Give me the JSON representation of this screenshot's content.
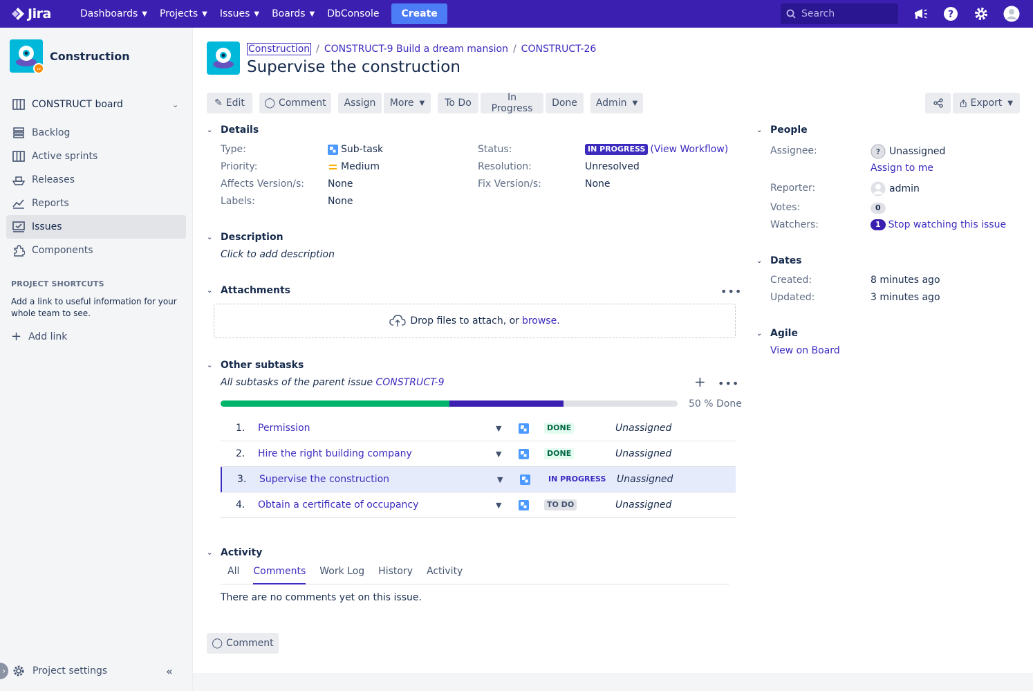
{
  "topnav": {
    "logo_text": "Jira",
    "items": [
      {
        "label": "Dashboards",
        "has_menu": true
      },
      {
        "label": "Projects",
        "has_menu": true
      },
      {
        "label": "Issues",
        "has_menu": true
      },
      {
        "label": "Boards",
        "has_menu": true
      },
      {
        "label": "DbConsole",
        "has_menu": false
      }
    ],
    "create_label": "Create",
    "search_placeholder": "Search",
    "accent": "#3b1fb0"
  },
  "sidebar": {
    "project_name": "Construction",
    "board_label": "CONSTRUCT board",
    "items": [
      {
        "label": "Backlog",
        "icon": "backlog-icon"
      },
      {
        "label": "Active sprints",
        "icon": "board-icon"
      },
      {
        "label": "Releases",
        "icon": "ship-icon"
      },
      {
        "label": "Reports",
        "icon": "chart-icon"
      },
      {
        "label": "Issues",
        "icon": "issues-icon",
        "active": true
      },
      {
        "label": "Components",
        "icon": "puzzle-icon"
      }
    ],
    "shortcuts_title": "PROJECT SHORTCUTS",
    "shortcuts_text": "Add a link to useful information for your whole team to see.",
    "add_link_label": "Add link",
    "settings_label": "Project settings"
  },
  "issue": {
    "breadcrumbs": [
      "Construction",
      "CONSTRUCT-9 Build a dream mansion",
      "CONSTRUCT-26"
    ],
    "title": "Supervise the construction",
    "toolbar": {
      "edit": "Edit",
      "comment": "Comment",
      "assign": "Assign",
      "more": "More",
      "todo": "To Do",
      "inprogress": "In Progress",
      "done": "Done",
      "admin": "Admin",
      "export": "Export"
    },
    "details": {
      "title": "Details",
      "type_label": "Type:",
      "type_value": "Sub-task",
      "priority_label": "Priority:",
      "priority_value": "Medium",
      "affects_label": "Affects Version/s:",
      "affects_value": "None",
      "labels_label": "Labels:",
      "labels_value": "None",
      "status_label": "Status:",
      "status_value": "IN PROGRESS",
      "workflow_link": "(View Workflow)",
      "resolution_label": "Resolution:",
      "resolution_value": "Unresolved",
      "fix_label": "Fix Version/s:",
      "fix_value": "None"
    },
    "description": {
      "title": "Description",
      "placeholder": "Click to add description"
    },
    "attachments": {
      "title": "Attachments",
      "drop_text": "Drop files to attach, or",
      "browse": "browse."
    },
    "subtasks": {
      "title": "Other subtasks",
      "subtitle": "All subtasks of the parent issue",
      "parent": "CONSTRUCT-9",
      "progress_text": "50 % Done",
      "done_fraction": 0.5,
      "inprogress_fraction": 0.25,
      "rows": [
        {
          "num": "1.",
          "name": "Permission",
          "status": "DONE",
          "assignee": "Unassigned"
        },
        {
          "num": "2.",
          "name": "Hire the right building company",
          "status": "DONE",
          "assignee": "Unassigned"
        },
        {
          "num": "3.",
          "name": "Supervise the construction",
          "status": "IN PROGRESS",
          "assignee": "Unassigned",
          "current": true
        },
        {
          "num": "4.",
          "name": "Obtain a certificate of occupancy",
          "status": "TO DO",
          "assignee": "Unassigned"
        }
      ]
    },
    "activity": {
      "title": "Activity",
      "tabs": [
        "All",
        "Comments",
        "Work Log",
        "History",
        "Activity"
      ],
      "active_tab": "Comments",
      "empty_text": "There are no comments yet on this issue.",
      "comment_button": "Comment"
    },
    "people": {
      "title": "People",
      "assignee_label": "Assignee:",
      "assignee_value": "Unassigned",
      "assign_to_me": "Assign to me",
      "reporter_label": "Reporter:",
      "reporter_value": "admin",
      "votes_label": "Votes:",
      "votes_value": "0",
      "watchers_label": "Watchers:",
      "watchers_count": "1",
      "watch_link": "Stop watching this issue"
    },
    "dates": {
      "title": "Dates",
      "created_label": "Created:",
      "created_value": "8 minutes ago",
      "updated_label": "Updated:",
      "updated_value": "3 minutes ago"
    },
    "agile": {
      "title": "Agile",
      "link": "View on Board"
    }
  }
}
